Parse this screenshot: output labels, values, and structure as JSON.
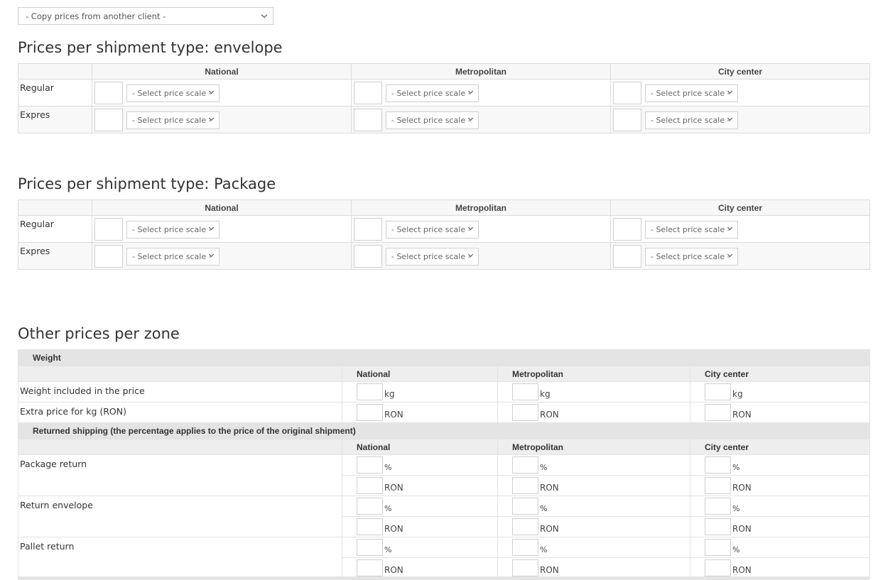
{
  "copy_prices": {
    "label": "- Copy prices from another client -"
  },
  "select_placeholder": "- Select price scale -",
  "shipment_sections": [
    {
      "title": "Prices per shipment type: envelope",
      "zones": [
        "National",
        "Metropolitan",
        "City center"
      ],
      "rows": [
        "Regular",
        "Expres"
      ]
    },
    {
      "title": "Prices per shipment type: Package",
      "zones": [
        "National",
        "Metropolitan",
        "City center"
      ],
      "rows": [
        "Regular",
        "Expres"
      ]
    }
  ],
  "other": {
    "title": "Other prices per zone",
    "zones": [
      "National",
      "Metropolitan",
      "City center"
    ],
    "weight": {
      "heading": "Weight",
      "rows": [
        {
          "label": "Weight included in the price",
          "unit": "kg"
        },
        {
          "label": "Extra price for kg (RON)",
          "unit": "RON"
        }
      ]
    },
    "returned": {
      "heading": "Returned shipping (the percentage applies to the price of the original shipment)",
      "units": [
        "%",
        "RON"
      ],
      "rows": [
        {
          "label": "Package return"
        },
        {
          "label": "Return envelope"
        },
        {
          "label": "Pallet return"
        }
      ]
    }
  }
}
